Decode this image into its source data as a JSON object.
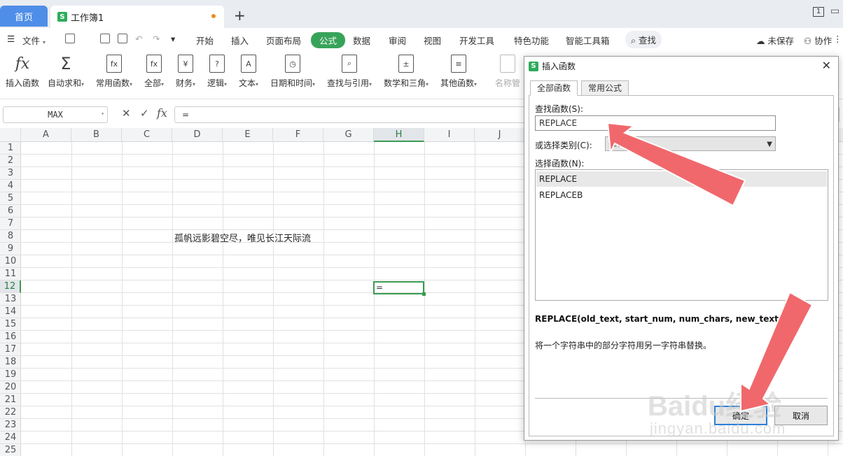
{
  "tabs": {
    "home": "首页",
    "workbook": "工作簿1"
  },
  "window": {
    "badge": "1"
  },
  "menu": {
    "file": "文件",
    "items": [
      "开始",
      "插入",
      "页面布局",
      "公式",
      "数据",
      "审阅",
      "视图",
      "开发工具",
      "特色功能",
      "智能工具箱"
    ],
    "search": "查找",
    "unsaved": "未保存",
    "collab": "协作"
  },
  "ribbon": [
    "插入函数",
    "自动求和",
    "常用函数",
    "全部",
    "财务",
    "逻辑",
    "文本",
    "日期和时间",
    "查找与引用",
    "数学和三角",
    "其他函数",
    "名称管"
  ],
  "ribbon_icons": [
    "fx-icon",
    "sigma-icon",
    "common-fn-icon",
    "all-fn-icon",
    "finance-icon",
    "logic-icon",
    "text-icon",
    "date-icon",
    "lookup-icon",
    "math-icon",
    "other-fn-icon",
    "name-mgr-icon"
  ],
  "formula_bar": {
    "name_box": "MAX",
    "content": "="
  },
  "columns": [
    "A",
    "B",
    "C",
    "D",
    "E",
    "F",
    "G",
    "H",
    "I",
    "J"
  ],
  "rows": [
    "1",
    "2",
    "3",
    "4",
    "5",
    "6",
    "7",
    "8",
    "9",
    "10",
    "11",
    "12",
    "13",
    "14",
    "15",
    "16",
    "17",
    "18",
    "19",
    "20",
    "21",
    "22",
    "23",
    "24",
    "25"
  ],
  "cells": {
    "D8": "孤帆远影碧空尽，唯见长江天际流",
    "H12": "="
  },
  "selected": {
    "column": "H",
    "row": "12"
  },
  "dialog": {
    "title": "插入函数",
    "tabs": [
      "全部函数",
      "常用公式"
    ],
    "search_label": "查找函数(S):",
    "search_value": "REPLACE",
    "category_label": "或选择类别(C):",
    "category_value": "推荐",
    "list_label": "选择函数(N):",
    "functions": [
      "REPLACE",
      "REPLACEB"
    ],
    "signature": "REPLACE(old_text, start_num, num_chars, new_text)",
    "description": "将一个字符串中的部分字符用另一字符串替换。",
    "ok": "确定",
    "cancel": "取消"
  },
  "watermark": {
    "main": "Baidu经验",
    "sub": "jingyan.baidu.com"
  },
  "colors": {
    "accent": "#37a35a",
    "home_tab": "#4f8ee8",
    "arrow": "#f0686c"
  }
}
